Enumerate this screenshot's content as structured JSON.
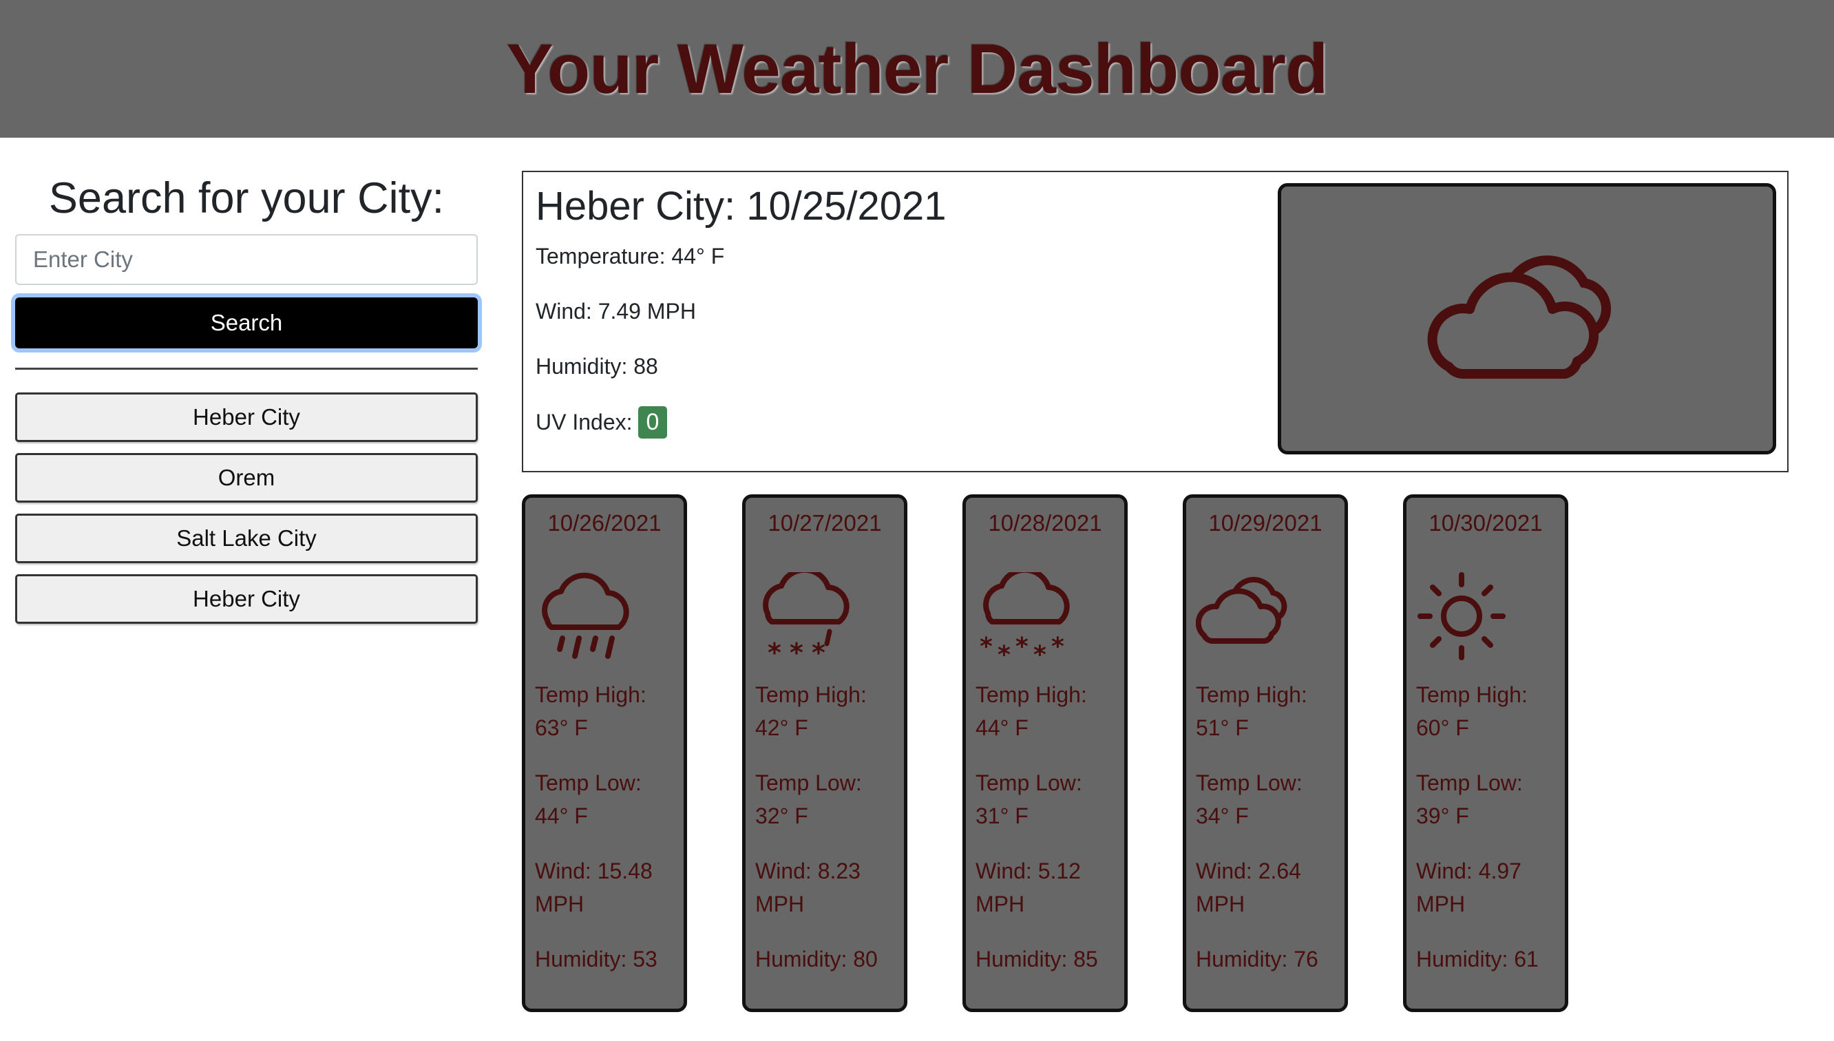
{
  "header": {
    "title": "Your Weather Dashboard"
  },
  "search": {
    "heading": "Search for your City:",
    "placeholder": "Enter City",
    "button_label": "Search"
  },
  "history": [
    {
      "label": "Heber City"
    },
    {
      "label": "Orem"
    },
    {
      "label": "Salt Lake City"
    },
    {
      "label": "Heber City"
    }
  ],
  "current": {
    "title": "Heber City: 10/25/2021",
    "temperature": "Temperature: 44° F",
    "wind": "Wind: 7.49 MPH",
    "humidity": "Humidity: 88",
    "uv_label": "UV Index:",
    "uv_value": "0",
    "icon": "partly-cloudy-icon"
  },
  "forecast": [
    {
      "date": "10/26/2021",
      "icon": "rain-cloud-icon",
      "high_label": "Temp High:",
      "high": "63° F",
      "low_label": "Temp Low:",
      "low": "44° F",
      "wind_label": "Wind: 15.48",
      "wind_unit": "MPH",
      "humidity": "Humidity: 53"
    },
    {
      "date": "10/27/2021",
      "icon": "snow-cloud-icon",
      "high_label": "Temp High:",
      "high": "42° F",
      "low_label": "Temp Low:",
      "low": "32° F",
      "wind_label": "Wind: 8.23",
      "wind_unit": "MPH",
      "humidity": "Humidity: 80"
    },
    {
      "date": "10/28/2021",
      "icon": "snow-cloud-icon",
      "high_label": "Temp High:",
      "high": "44° F",
      "low_label": "Temp Low:",
      "low": "31° F",
      "wind_label": "Wind: 5.12",
      "wind_unit": "MPH",
      "humidity": "Humidity: 85"
    },
    {
      "date": "10/29/2021",
      "icon": "partly-cloudy-icon",
      "high_label": "Temp High:",
      "high": "51° F",
      "low_label": "Temp Low:",
      "low": "34° F",
      "wind_label": "Wind: 2.64",
      "wind_unit": "MPH",
      "humidity": "Humidity: 76"
    },
    {
      "date": "10/30/2021",
      "icon": "sun-icon",
      "high_label": "Temp High:",
      "high": "60° F",
      "low_label": "Temp Low:",
      "low": "39° F",
      "wind_label": "Wind: 4.97",
      "wind_unit": "MPH",
      "humidity": "Humidity: 61"
    }
  ],
  "colors": {
    "header_bg": "#676767",
    "title_text": "#4a0e0e",
    "card_bg": "#676767",
    "uv_badge": "#3f8550",
    "search_button": "#000000"
  }
}
